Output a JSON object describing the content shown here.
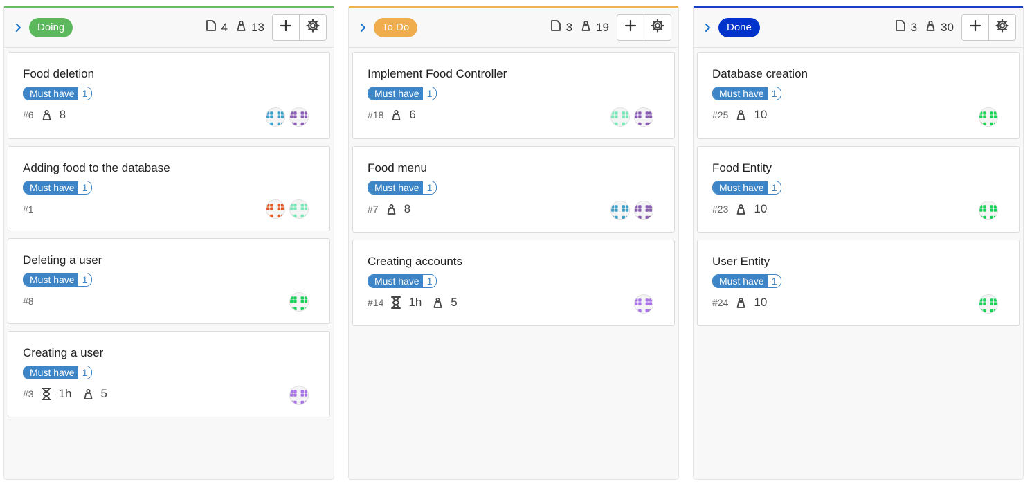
{
  "columns": [
    {
      "title": "Doing",
      "color": "#5cb85c",
      "top_color": "#6bbd63",
      "issues": "4",
      "weight": "13",
      "cards": [
        {
          "title": "Food deletion",
          "label": "Must have",
          "label_count": "1",
          "number": "#6",
          "time": null,
          "weight": "8",
          "avatars": [
            "#3fa0c8",
            "#8a5fb0"
          ],
          "h": 126
        },
        {
          "title": "Adding food to the database",
          "label": "Must have",
          "label_count": "1",
          "number": "#1",
          "time": null,
          "weight": null,
          "avatars": [
            "#e05a2b",
            "#7de6b8"
          ],
          "h": 123
        },
        {
          "title": "Deleting a user",
          "label": "Must have",
          "label_count": "1",
          "number": "#8",
          "time": null,
          "weight": null,
          "avatars": [
            "#1fd15a"
          ],
          "h": 124
        },
        {
          "title": "Creating a user",
          "label": "Must have",
          "label_count": "1",
          "number": "#3",
          "time": "1h",
          "weight": "5",
          "avatars": [
            "#a874e6"
          ],
          "h": 125
        }
      ]
    },
    {
      "title": "To Do",
      "color": "#f0ad4e",
      "top_color": "#f0b44e",
      "issues": "3",
      "weight": "19",
      "cards": [
        {
          "title": "Implement Food Controller",
          "label": "Must have",
          "label_count": "1",
          "number": "#18",
          "time": null,
          "weight": "6",
          "avatars": [
            "#7de6b8",
            "#8a5fb0"
          ],
          "h": 126
        },
        {
          "title": "Food menu",
          "label": "Must have",
          "label_count": "1",
          "number": "#7",
          "time": null,
          "weight": "8",
          "avatars": [
            "#3fa0c8",
            "#8a5fb0"
          ],
          "h": 125
        },
        {
          "title": "Creating accounts",
          "label": "Must have",
          "label_count": "1",
          "number": "#14",
          "time": "1h",
          "weight": "5",
          "avatars": [
            "#a874e6"
          ],
          "h": 125
        }
      ]
    },
    {
      "title": "Done",
      "color": "#0033cc",
      "top_color": "#1a3fc2",
      "issues": "3",
      "weight": "30",
      "cards": [
        {
          "title": "Database creation",
          "label": "Must have",
          "label_count": "1",
          "number": "#25",
          "time": null,
          "weight": "10",
          "avatars": [
            "#1fd15a"
          ],
          "h": 126
        },
        {
          "title": "Food Entity",
          "label": "Must have",
          "label_count": "1",
          "number": "#23",
          "time": null,
          "weight": "10",
          "avatars": [
            "#1fd15a"
          ],
          "h": 125
        },
        {
          "title": "User Entity",
          "label": "Must have",
          "label_count": "1",
          "number": "#24",
          "time": null,
          "weight": "10",
          "avatars": [
            "#1fd15a"
          ],
          "h": 125
        }
      ]
    }
  ]
}
